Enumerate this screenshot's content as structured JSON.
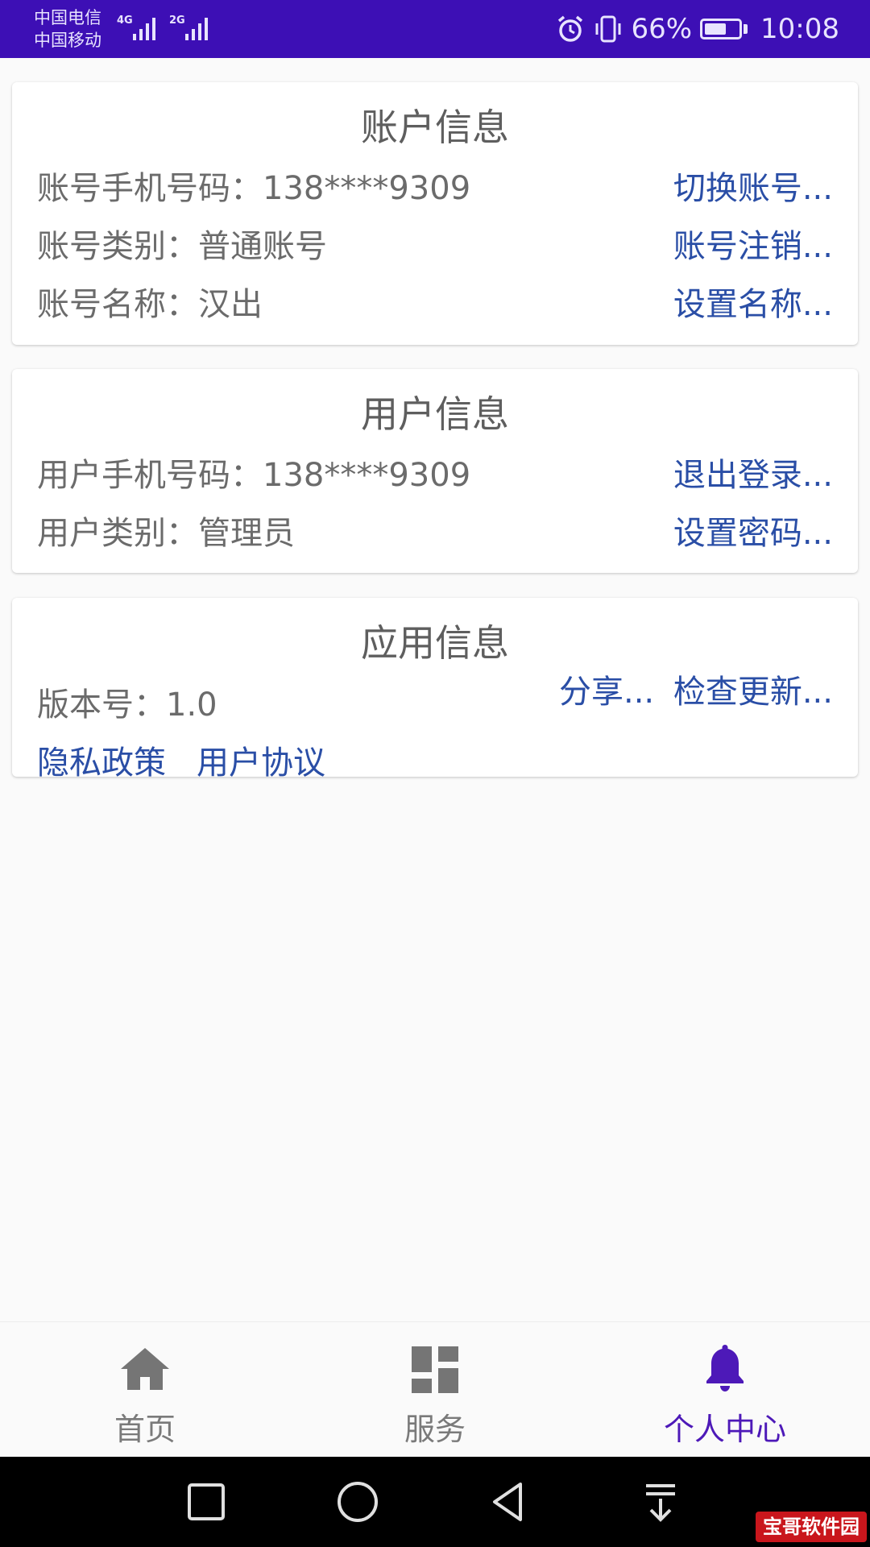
{
  "status_bar": {
    "carrier_1": "中国电信",
    "carrier_2": "中国移动",
    "network_1": "4G",
    "network_2": "2G",
    "battery_percent": "66%",
    "battery_level": 0.66,
    "time": "10:08",
    "icons": [
      "alarm-icon",
      "vibrate-icon",
      "battery-icon"
    ]
  },
  "account_card": {
    "title": "账户信息",
    "rows": [
      {
        "label": "账号手机号码：138****9309",
        "action": "切换账号..."
      },
      {
        "label": "账号类别：普通账号",
        "action": "账号注销..."
      },
      {
        "label": "账号名称：汉出",
        "action": "设置名称..."
      }
    ]
  },
  "user_card": {
    "title": "用户信息",
    "rows": [
      {
        "label": "用户手机号码：138****9309",
        "action": "退出登录..."
      },
      {
        "label": "用户类别：管理员",
        "action": "设置密码..."
      }
    ]
  },
  "app_card": {
    "title": "应用信息",
    "version_label": "版本号：1.0",
    "share_label": "分享...",
    "check_update_label": "检查更新...",
    "privacy_label": "隐私政策",
    "agreement_label": "用户协议"
  },
  "bottom_nav": {
    "items": [
      {
        "label": "首页",
        "icon": "home-icon"
      },
      {
        "label": "服务",
        "icon": "dashboard-icon"
      },
      {
        "label": "个人中心",
        "icon": "bell-icon"
      }
    ],
    "active_index": 2
  },
  "system_nav": {
    "icons": [
      "recent-apps-icon",
      "home-circle-icon",
      "back-icon",
      "notification-pull-icon"
    ]
  },
  "watermark": "宝哥软件园",
  "colors": {
    "status_bar": "#3d0fb5",
    "link": "#2a4ea6",
    "active_tab": "#4d19b8"
  }
}
